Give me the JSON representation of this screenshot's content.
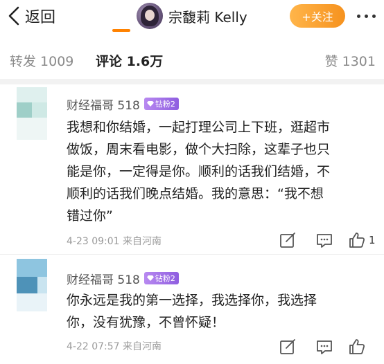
{
  "header": {
    "back_label": "返回",
    "profile_name": "宗馥莉 Kelly",
    "follow_label": "+关注"
  },
  "tabs": {
    "repost": "转发 1009",
    "comments": "评论 1.6万",
    "likes": "赞 1301"
  },
  "colors": {
    "accent": "#ff8200",
    "follow_button": "#f6921e",
    "badge": "#9b6ae6"
  },
  "comments": [
    {
      "username": "财经福哥 518",
      "badge": "钻粉2",
      "lines": [
        "我想和你结婚，一起打理公司上下班，逛超市",
        "做饭，周末看电影，做个大扫除，这辈子也只",
        "能是你，一定得是你。顺利的话我们结婚，不",
        "顺利的话我们晚点结婚。我的意思：“我不想",
        "错过你”"
      ],
      "time": "4-23 09:01",
      "location": "来自河南",
      "meta": "4-23 09:01  来自河南",
      "likes": "1"
    },
    {
      "username": "财经福哥 518",
      "badge": "钻粉2",
      "lines": [
        "你永远是我的第一选择，我选择你，我选择",
        "你，没有犹豫，不曾怀疑！"
      ],
      "time": "4-22 07:57",
      "location": "来自河南",
      "meta": "4-22 07:57  来自河南",
      "likes": ""
    }
  ],
  "icons": [
    "back-chevron-icon",
    "more-icon",
    "edit-icon",
    "reply-icon",
    "like-icon",
    "diamond-icon"
  ]
}
